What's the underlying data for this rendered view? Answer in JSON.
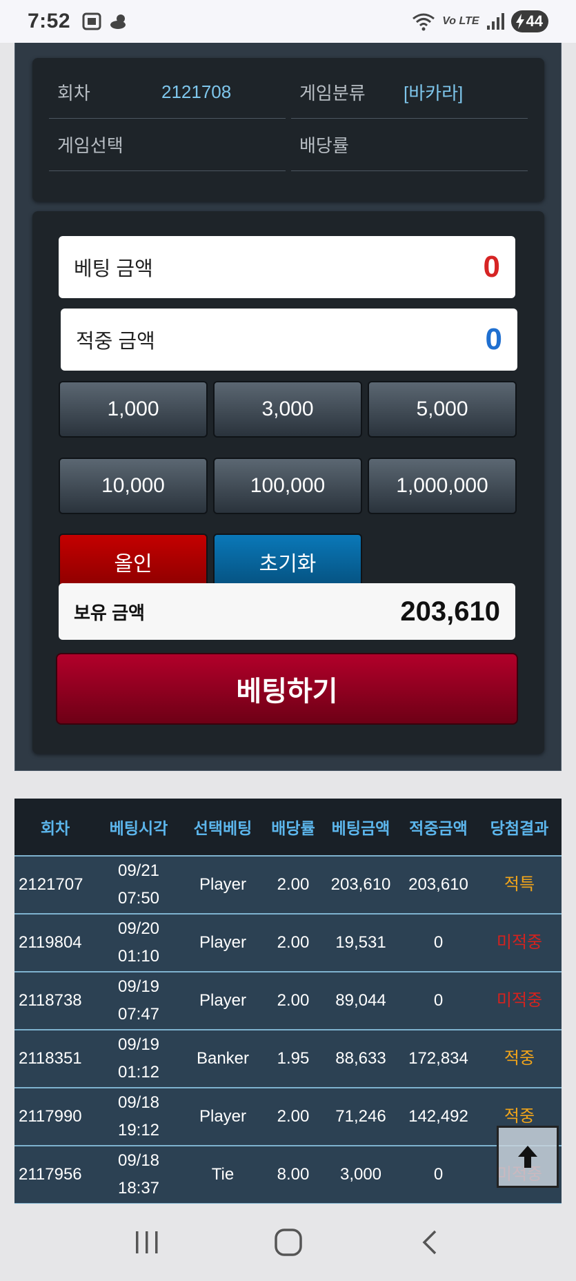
{
  "status_bar": {
    "time": "7:52",
    "battery": "44",
    "network": "Vo LTE"
  },
  "info": {
    "round_label": "회차",
    "round_value": "2121708",
    "category_label": "게임분류",
    "category_value": "[바카라]",
    "selection_label": "게임선택",
    "selection_value": "",
    "odds_label": "배당률",
    "odds_value": ""
  },
  "bet": {
    "bet_amount_label": "베팅 금액",
    "bet_amount_value": "0",
    "win_amount_label": "적중 금액",
    "win_amount_value": "0",
    "chips": [
      "1,000",
      "3,000",
      "5,000",
      "10,000",
      "100,000",
      "1,000,000"
    ],
    "allin_label": "올인",
    "reset_label": "초기화",
    "balance_label": "보유 금액",
    "balance_value": "203,610",
    "submit_label": "베팅하기",
    "colors": {
      "bet_value": "#d62424",
      "win_value": "#1f6fd0"
    }
  },
  "history": {
    "headers": [
      "회차",
      "베팅시각",
      "선택베팅",
      "배당률",
      "베팅금액",
      "적중금액",
      "당첨결과"
    ],
    "rows": [
      {
        "round": "2121707",
        "date": "09/21",
        "time": "07:50",
        "pick": "Player",
        "odds": "2.00",
        "bet": "203,610",
        "win": "203,610",
        "result": "적특",
        "status": "win"
      },
      {
        "round": "2119804",
        "date": "09/20",
        "time": "01:10",
        "pick": "Player",
        "odds": "2.00",
        "bet": "19,531",
        "win": "0",
        "result": "미적중",
        "status": "lose"
      },
      {
        "round": "2118738",
        "date": "09/19",
        "time": "07:47",
        "pick": "Player",
        "odds": "2.00",
        "bet": "89,044",
        "win": "0",
        "result": "미적중",
        "status": "lose"
      },
      {
        "round": "2118351",
        "date": "09/19",
        "time": "01:12",
        "pick": "Banker",
        "odds": "1.95",
        "bet": "88,633",
        "win": "172,834",
        "result": "적중",
        "status": "win"
      },
      {
        "round": "2117990",
        "date": "09/18",
        "time": "19:12",
        "pick": "Player",
        "odds": "2.00",
        "bet": "71,246",
        "win": "142,492",
        "result": "적중",
        "status": "win"
      },
      {
        "round": "2117956",
        "date": "09/18",
        "time": "18:37",
        "pick": "Tie",
        "odds": "8.00",
        "bet": "3,000",
        "win": "0",
        "result": "미적중",
        "status": "lose"
      }
    ]
  }
}
